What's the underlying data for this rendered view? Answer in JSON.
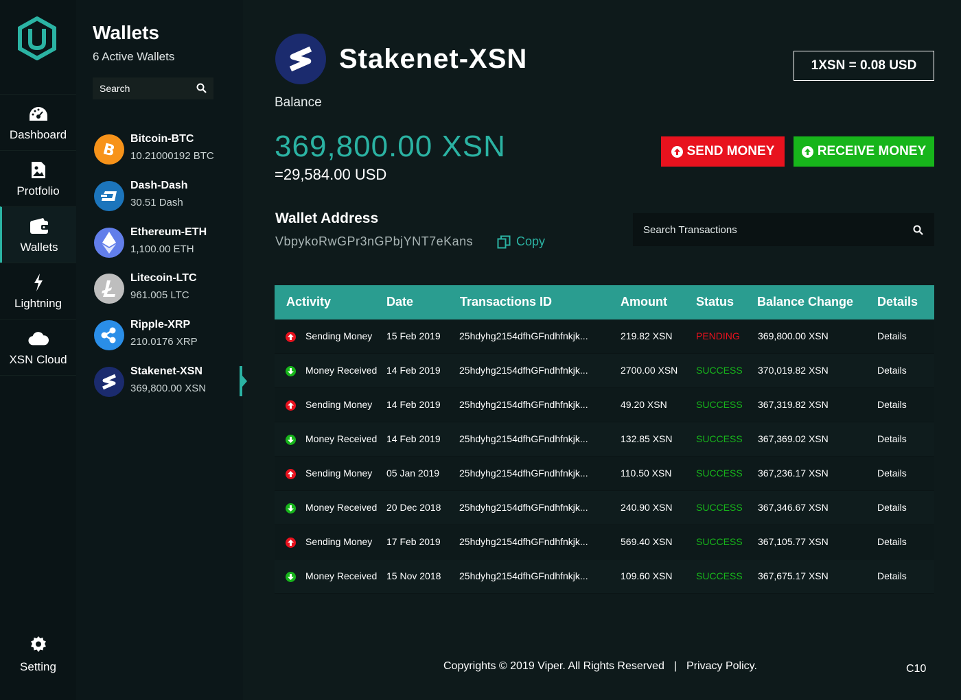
{
  "nav": {
    "items": [
      {
        "label": "Dashboard",
        "icon": "dashboard-icon"
      },
      {
        "label": "Protfolio",
        "icon": "portfolio-icon"
      },
      {
        "label": "Wallets",
        "icon": "wallet-icon"
      },
      {
        "label": "Lightning",
        "icon": "lightning-icon"
      },
      {
        "label": "XSN Cloud",
        "icon": "cloud-icon"
      }
    ],
    "setting": "Setting"
  },
  "wallets": {
    "title": "Wallets",
    "subtitle": "6 Active Wallets",
    "search_placeholder": "Search",
    "items": [
      {
        "name": "Bitcoin-BTC",
        "balance": "10.21000192 BTC",
        "color": "#f7931a"
      },
      {
        "name": "Dash-Dash",
        "balance": "30.51 Dash",
        "color": "#1c75bc"
      },
      {
        "name": "Ethereum-ETH",
        "balance": "1,100.00 ETH",
        "color": "#627eea"
      },
      {
        "name": "Litecoin-LTC",
        "balance": "961.005 LTC",
        "color": "#bebebe"
      },
      {
        "name": "Ripple-XRP",
        "balance": "210.0176 XRP",
        "color": "#2a8ee8"
      },
      {
        "name": "Stakenet-XSN",
        "balance": "369,800.00 XSN",
        "color": "#1b2b6e"
      }
    ]
  },
  "main": {
    "title": "Stakenet-XSN",
    "rate": "1XSN = 0.08 USD",
    "balance_label": "Balance",
    "balance_amount": "369,800.00 XSN",
    "balance_usd": "=29,584.00 USD",
    "send_label": "SEND MONEY",
    "receive_label": "RECEIVE MONEY",
    "address_label": "Wallet Address",
    "address": "VbpykoRwGPr3nGPbjYNT7eKans",
    "copy_label": "Copy",
    "tx_search_placeholder": "Search Transactions"
  },
  "table": {
    "headers": [
      "Activity",
      "Date",
      "Transactions ID",
      "Amount",
      "Status",
      "Balance Change",
      "Details"
    ],
    "rows": [
      {
        "type": "send",
        "activity": "Sending Money",
        "date": "15 Feb 2019",
        "txid": "25hdyhg2154dfhGFndhfnkjk...",
        "amount": "219.82 XSN",
        "status": "PENDING",
        "balance": "369,800.00 XSN",
        "details": "Details"
      },
      {
        "type": "receive",
        "activity": "Money Received",
        "date": "14 Feb 2019",
        "txid": "25hdyhg2154dfhGFndhfnkjk...",
        "amount": "2700.00 XSN",
        "status": "SUCCESS",
        "balance": "370,019.82 XSN",
        "details": "Details"
      },
      {
        "type": "send",
        "activity": "Sending Money",
        "date": "14 Feb 2019",
        "txid": "25hdyhg2154dfhGFndhfnkjk...",
        "amount": "49.20 XSN",
        "status": "SUCCESS",
        "balance": "367,319.82 XSN",
        "details": "Details"
      },
      {
        "type": "receive",
        "activity": "Money Received",
        "date": "14 Feb 2019",
        "txid": "25hdyhg2154dfhGFndhfnkjk...",
        "amount": "132.85 XSN",
        "status": "SUCCESS",
        "balance": "367,369.02 XSN",
        "details": "Details"
      },
      {
        "type": "send",
        "activity": "Sending Money",
        "date": "05 Jan 2019",
        "txid": "25hdyhg2154dfhGFndhfnkjk...",
        "amount": "110.50 XSN",
        "status": "SUCCESS",
        "balance": "367,236.17 XSN",
        "details": "Details"
      },
      {
        "type": "receive",
        "activity": "Money Received",
        "date": "20 Dec 2018",
        "txid": "25hdyhg2154dfhGFndhfnkjk...",
        "amount": "240.90 XSN",
        "status": "SUCCESS",
        "balance": "367,346.67 XSN",
        "details": "Details"
      },
      {
        "type": "send",
        "activity": "Sending Money",
        "date": "17 Feb 2019",
        "txid": "25hdyhg2154dfhGFndhfnkjk...",
        "amount": "569.40 XSN",
        "status": "SUCCESS",
        "balance": "367,105.77 XSN",
        "details": "Details"
      },
      {
        "type": "receive",
        "activity": "Money Received",
        "date": "15 Nov 2018",
        "txid": "25hdyhg2154dfhGFndhfnkjk...",
        "amount": "109.60 XSN",
        "status": "SUCCESS",
        "balance": "367,675.17 XSN",
        "details": "Details"
      }
    ]
  },
  "footer": {
    "copyright": "Copyrights © 2019 Viper.  All Rights Reserved",
    "separator": "|",
    "privacy": "Privacy Policy.",
    "version": "C10"
  },
  "colors": {
    "accent": "#2bb3a3",
    "send": "#e8121e",
    "receive": "#17b51b"
  }
}
